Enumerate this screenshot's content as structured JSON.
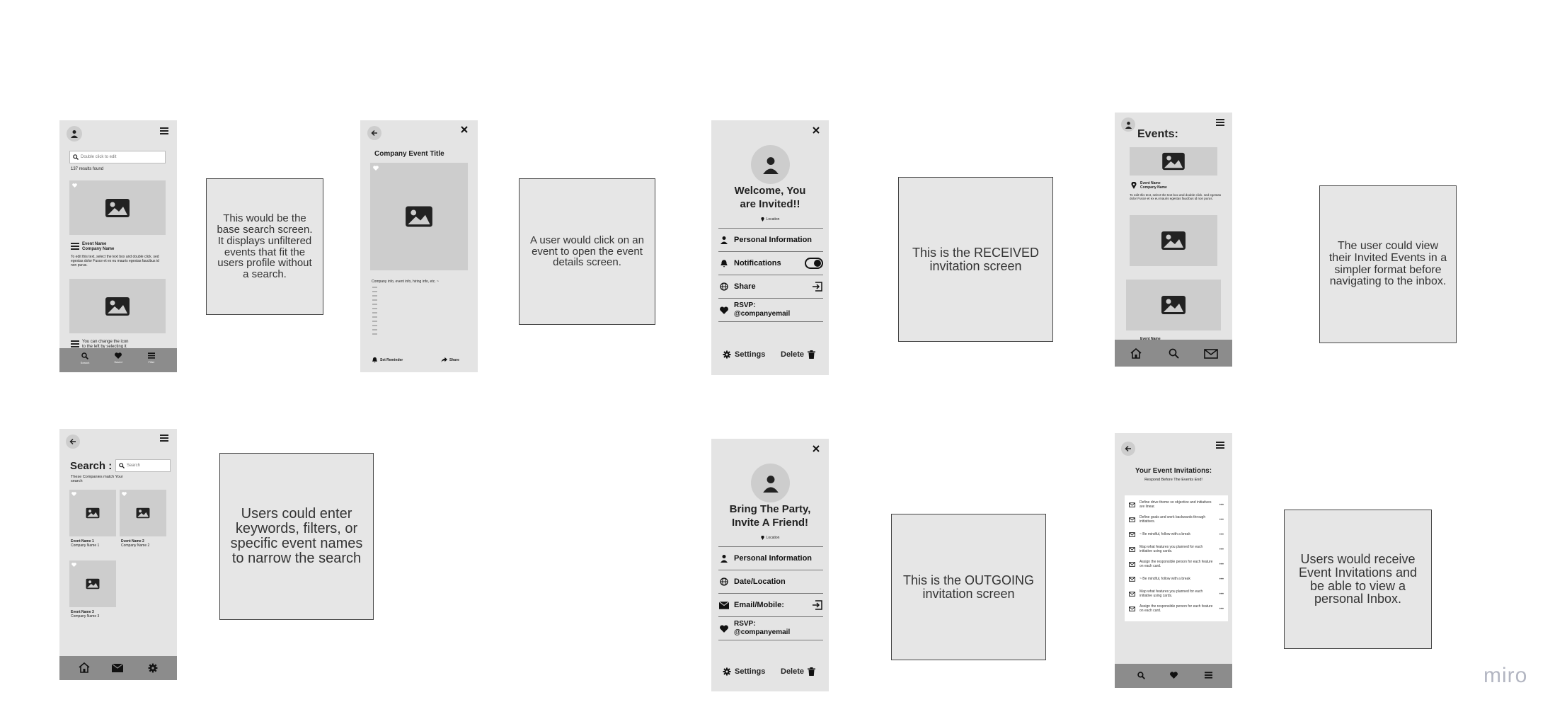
{
  "colors": {
    "canvas": "#ffffff",
    "phone_bg": "#e4e4e4",
    "placeholder": "#cdcdcd",
    "dark_bar": "#8c8c8c",
    "note_bg": "#e6e6e6",
    "note_border": "#444444",
    "logo": "#b3b6c2"
  },
  "screen1": {
    "search_placeholder": "Double click to edit",
    "results": "137 results found",
    "event_name": "Event Name",
    "company_name": "Company Name",
    "body_text": "To edit this text, select the text box and double click. sed egestas dolor Fusce et ex eu mauris egestas faucibus id non purus.",
    "teaser": "You can change the icon to the left by selecting it",
    "nav": [
      "Search",
      "Saved",
      "Filter"
    ]
  },
  "note1": "This would be the base search screen. It displays unfiltered events that fit the users profile without a search.",
  "screen2": {
    "title": "Company Event Title",
    "info": "Company info, event info, hiring info, etc. ~",
    "reminder": "Set Reminder",
    "share": "Share"
  },
  "note2": "A user would click on an event to open the event details screen.",
  "screen3": {
    "heading": "Welcome, You are Invited!!",
    "location": "Location",
    "rows": [
      "Personal Information",
      "Notifications",
      "Share"
    ],
    "rsvp_label": "RSVP:",
    "rsvp_email": "@companyemail",
    "settings": "Settings",
    "delete": "Delete"
  },
  "note3": "This is the RECEIVED invitation screen",
  "screen4": {
    "title": "Events:",
    "event_name": "Event Name",
    "company_name": "Company Name",
    "body_text": "To edit this text, select the text box and double click. sed egestas dolor Fusce et ex eu mauris egestas faucibus id non purus.",
    "cut_label": "Event Name"
  },
  "note4": "The user could view their Invited Events in a simpler format before navigating to the inbox.",
  "screen5": {
    "search_label": "Search :",
    "search_placeholder": "Search",
    "match_text": "These Companies match Your search",
    "cards": [
      {
        "event": "Event Name 1",
        "company": "Company Name 1"
      },
      {
        "event": "Event Name 2",
        "company": "Company Name 2"
      },
      {
        "event": "Event Name 3",
        "company": "Company Name 3"
      }
    ]
  },
  "note5": "Users could enter keywords, filters, or specific event names to narrow the search",
  "screen6": {
    "heading": "Bring The Party, Invite A Friend!",
    "location": "Location",
    "rows": [
      "Personal Information",
      "Date/Location",
      "Email/Mobile:"
    ],
    "rsvp_label": "RSVP:",
    "rsvp_email": "@companyemail",
    "settings": "Settings",
    "delete": "Delete"
  },
  "note6": "This is the OUTGOING invitation screen",
  "screen7": {
    "title": "Your Event Invitations:",
    "subtitle": "Respond Before The Events End!",
    "items": [
      "Define drive theme so objective and initiatives are linear.",
      "Define goals and work backwards through initiatives.",
      "~ Be mindful, follow with a break",
      "Map what features you planned for each initiative using cards.",
      "Assign the responsible person for each feature on each card.",
      "~ Be mindful, follow with a break",
      "Map what features you planned for each initiative using cards.",
      "Assign the responsible person for each feature on each card."
    ]
  },
  "note7": "Users would receive Event Invitations and be able to view a personal Inbox.",
  "logo": "miro"
}
